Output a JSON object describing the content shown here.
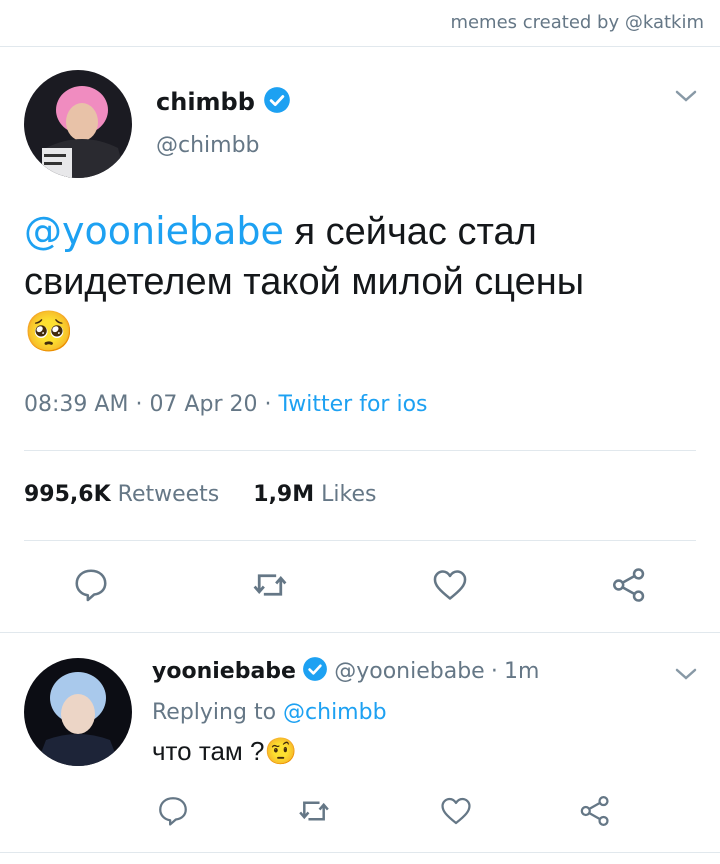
{
  "credit": "memes created by @katkim",
  "main_tweet": {
    "display_name": "chimbb",
    "handle": "@chimbb",
    "mention": "@yooniebabe",
    "text": "я сейчас стал свидетелем такой милой сцены",
    "emoji": "🥺",
    "time": "08:39 AM",
    "date": "07 Apr 20",
    "source": "Twitter for ios",
    "retweets_count": "995,6K",
    "retweets_label": "Retweets",
    "likes_count": "1,9M",
    "likes_label": "Likes"
  },
  "reply": {
    "display_name": "yooniebabe",
    "handle": "@yooniebabe",
    "age": "1m",
    "replying_prefix": "Replying to",
    "replying_to": "@chimbb",
    "text": "что там ?",
    "emoji": "🤨"
  },
  "colors": {
    "accent": "#1da1f2",
    "muted": "#657786",
    "divider": "#e1e8ed"
  }
}
